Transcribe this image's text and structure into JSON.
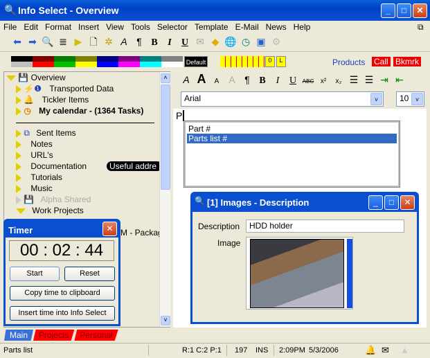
{
  "window": {
    "title": "Info Select - Overview"
  },
  "menu": [
    "File",
    "Edit",
    "Format",
    "Insert",
    "View",
    "Tools",
    "Selector",
    "Template",
    "E-Mail",
    "News",
    "Help"
  ],
  "palette": {
    "top": [
      "#000000",
      "#800000",
      "#008000",
      "#808000",
      "#000080",
      "#800080",
      "#008080",
      "#808080"
    ],
    "bottom": [
      "#c0c0c0",
      "#ff0000",
      "#00c000",
      "#ffff00",
      "#0000ff",
      "#ff00ff",
      "#00ffff",
      "#ffffff"
    ],
    "default_label": "Default"
  },
  "view_buttons": [
    "0",
    "L"
  ],
  "top_tabs": [
    "Products",
    "Call",
    "Bkmrk"
  ],
  "tree": {
    "overview": "Overview",
    "transported": "Transported Data",
    "tickler": "Tickler Items",
    "calendar": "My calendar - (1364 Tasks)",
    "sent": "Sent Items",
    "notes": "Notes",
    "urls": "URL's",
    "documentation": "Documentation",
    "doc_note": "Useful addre",
    "tutorials": "Tutorials",
    "music": "Music",
    "alpha": "Alpha Shared",
    "work": "Work Projects",
    "package": "M - Packag"
  },
  "timer": {
    "title": "Timer",
    "time": "00 : 02 : 44",
    "start": "Start",
    "reset": "Reset",
    "copy": "Copy time to clipboard",
    "insert": "Insert time into Info Select"
  },
  "bottom_tabs": [
    "Main",
    "Projects",
    "Personal"
  ],
  "editor": {
    "font": "Arial",
    "size": "10",
    "text": "P",
    "suggestions": [
      "Part #",
      "Parts list #"
    ]
  },
  "images_window": {
    "title": "[1] Images - Description",
    "description_label": "Description",
    "description_value": "HDD holder",
    "image_label": "Image"
  },
  "status": {
    "left": "Parts list",
    "position": "R:1 C:2 P:1",
    "count": "197",
    "mode": "INS",
    "time": "2:09PM",
    "date": "5/3/2006"
  }
}
